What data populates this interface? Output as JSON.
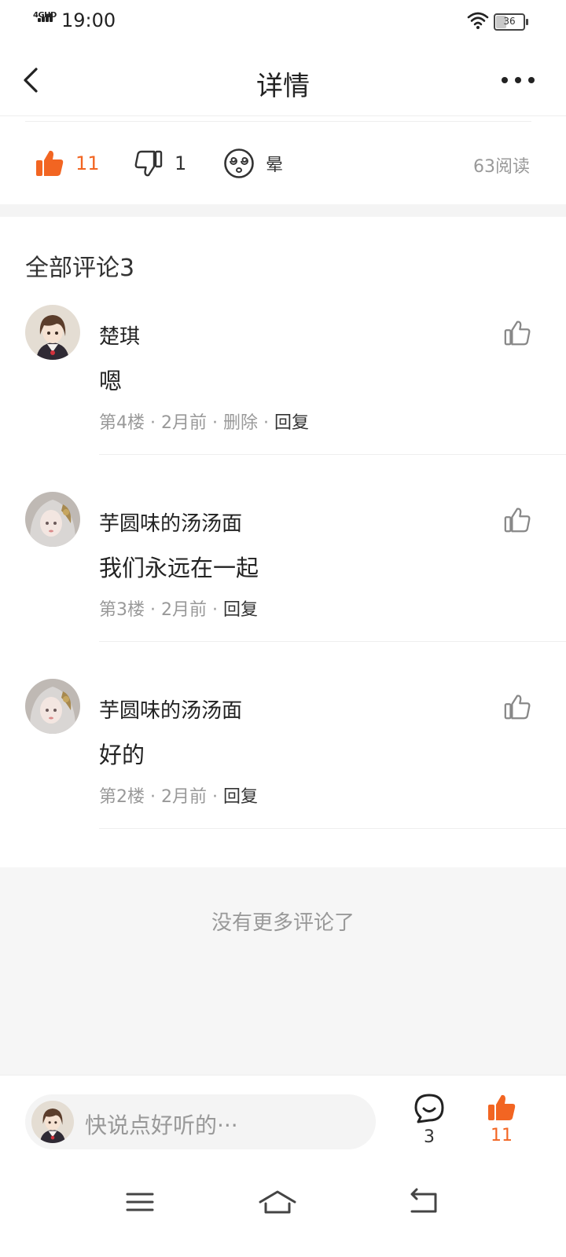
{
  "status_bar": {
    "network": "4GHD",
    "time": "19:00",
    "battery": "36",
    "battery_level": 0.36
  },
  "nav": {
    "title": "详情"
  },
  "reactions": {
    "like_count": "11",
    "dislike_count": "1",
    "dizzy_label": "晕",
    "reads": "63阅读"
  },
  "comments_section": {
    "title": "全部评论3"
  },
  "comments": [
    {
      "name": "楚琪",
      "text": "嗯",
      "floor": "第4楼",
      "time": "2月前",
      "delete": "删除",
      "reply": "回复"
    },
    {
      "name": "芋圆味的汤汤面",
      "text": "我们永远在一起",
      "floor": "第3楼",
      "time": "2月前",
      "reply": "回复"
    },
    {
      "name": "芋圆味的汤汤面",
      "text": "好的",
      "floor": "第2楼",
      "time": "2月前",
      "reply": "回复"
    }
  ],
  "no_more": "没有更多评论了",
  "bottom_bar": {
    "placeholder": "快说点好听的···",
    "comment_count": "3",
    "like_count": "11"
  },
  "colors": {
    "accent": "#f26522",
    "muted_text": "#999999",
    "separator": "#f4f4f4"
  },
  "icons": {
    "back": "chevron-left-icon",
    "more": "more-dots-icon",
    "like": "thumbs-up-icon",
    "dislike": "thumbs-down-icon",
    "dizzy": "dizzy-face-icon",
    "comment": "comment-bubble-icon"
  }
}
